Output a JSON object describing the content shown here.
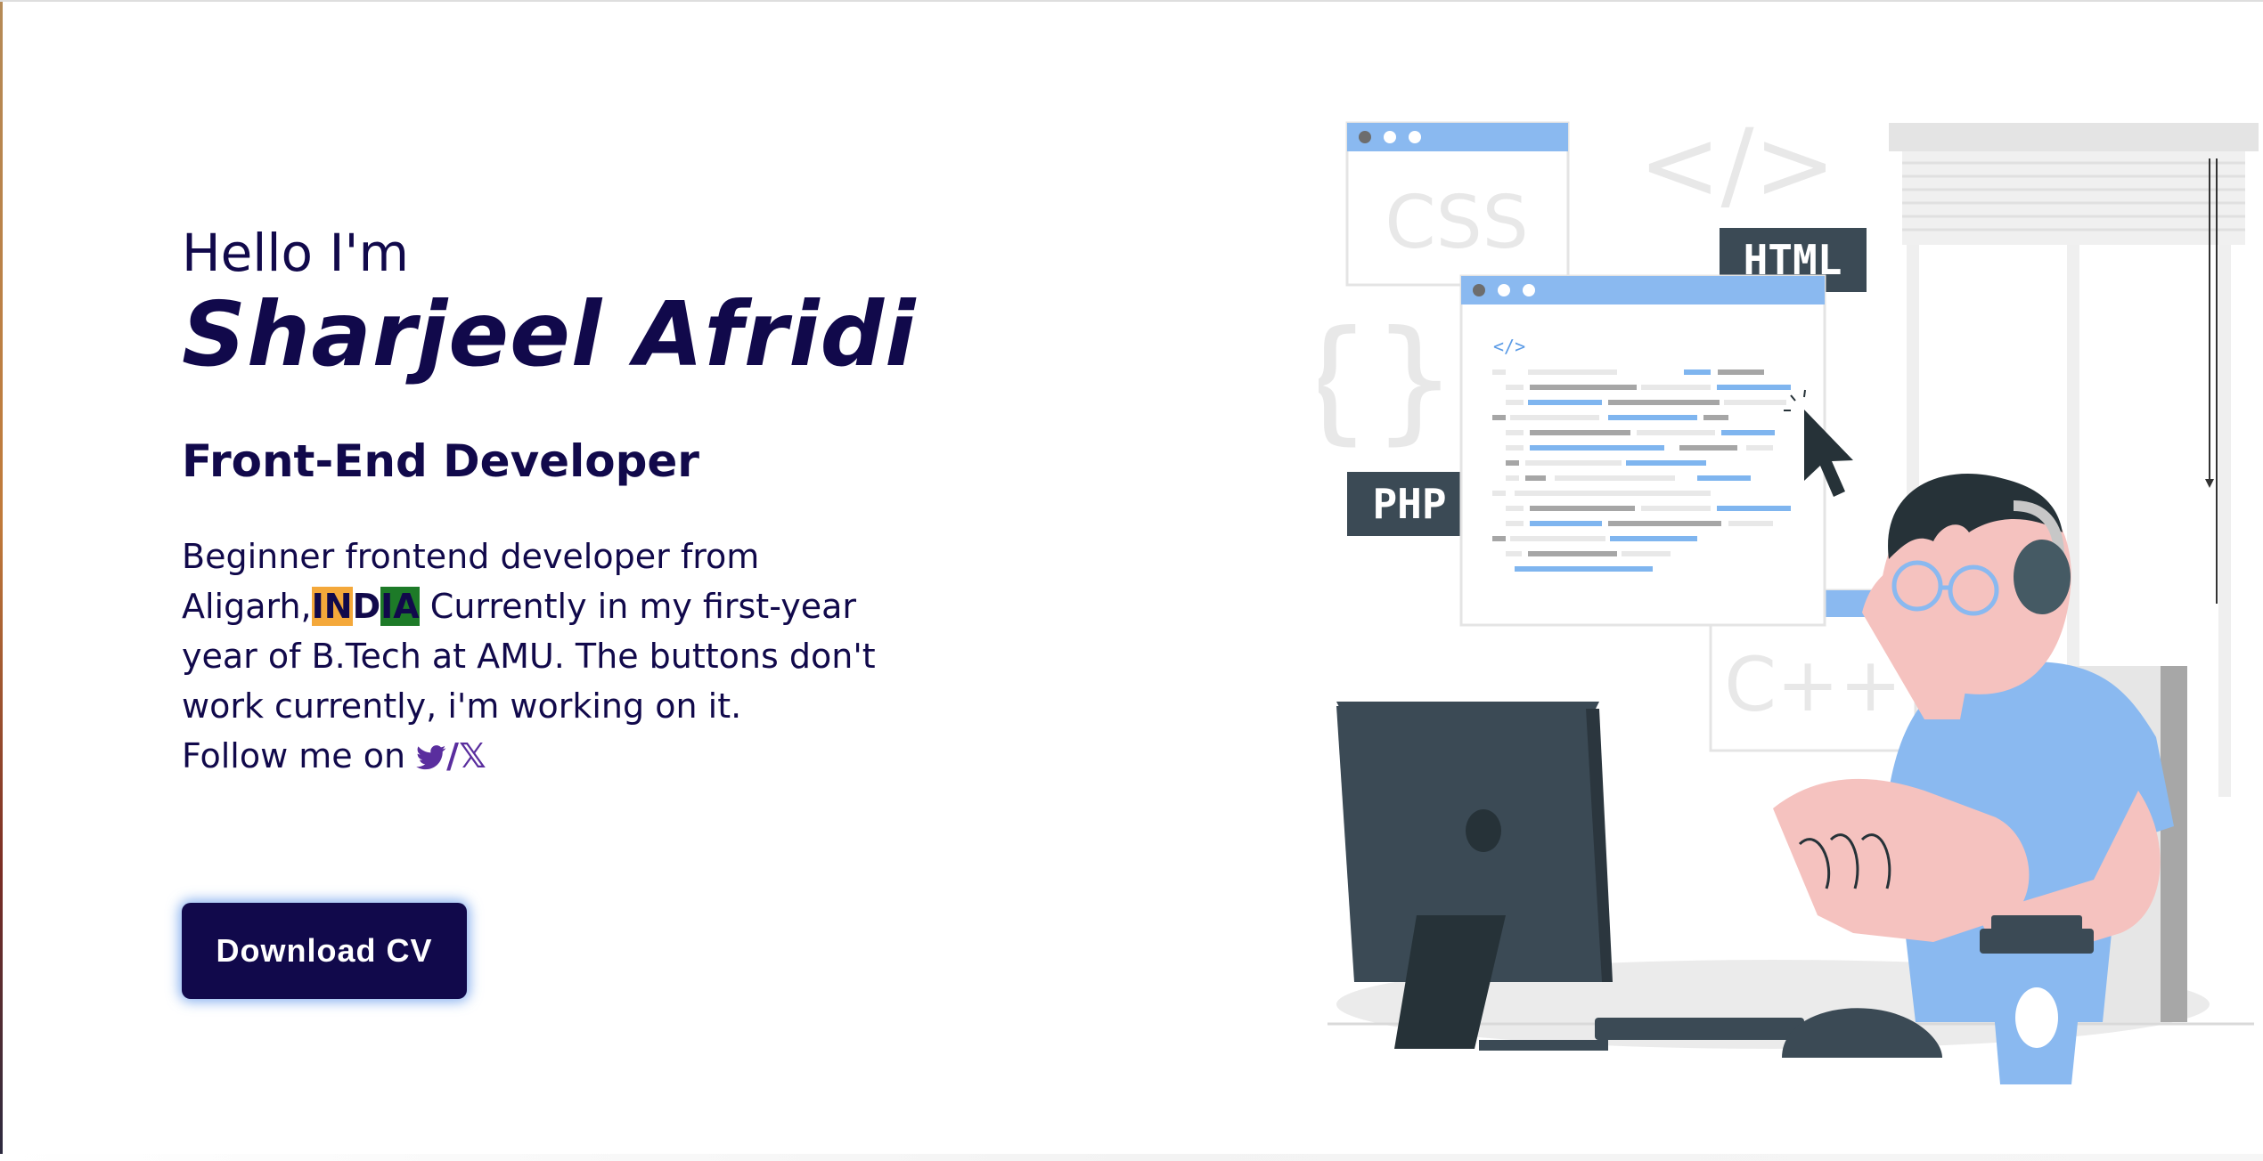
{
  "hero": {
    "greeting": "Hello I'm",
    "name": "Sharjeel Afridi",
    "role": "Front-End Developer",
    "bio_before": "Beginner frontend developer from Aligarh,",
    "country_in": "IN",
    "country_d": "D",
    "country_ia": "IA",
    "bio_after": " Currently in my first-year year of B.Tech at AMU. The buttons don't work currently, i'm working on it.",
    "follow_text": "Follow me on ",
    "twitter_icon": "twitter-bird-icon",
    "slash": "/",
    "x_icon_glyph": "𝕏",
    "flag_colors": {
      "saffron": "#f4a83a",
      "green": "#1d7a28"
    }
  },
  "cta": {
    "download_label": "Download CV"
  },
  "illustration": {
    "css_label": "CSS",
    "html_label": "HTML",
    "php_label": "PHP",
    "cpp_label": "C++",
    "tag_symbol": "</>",
    "small_tag": "</>",
    "braces": "{}"
  },
  "colors": {
    "text": "#11094b",
    "button": "#11094b",
    "glow": "#4384e6",
    "accent_blue": "#8ab9f0",
    "dark_slate": "#3b4a55",
    "skin": "#f5c2bf"
  }
}
